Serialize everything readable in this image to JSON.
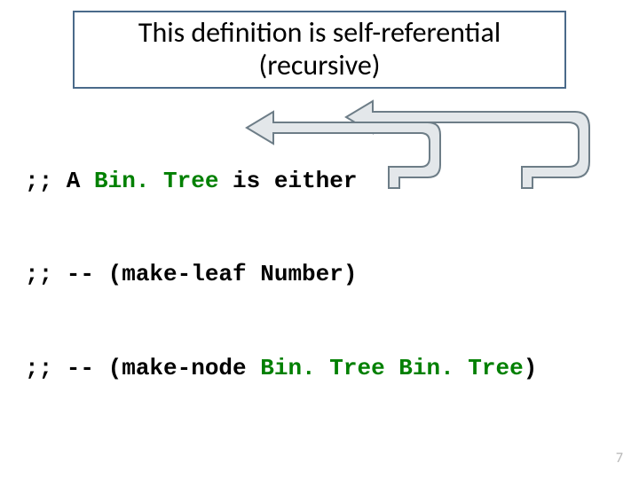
{
  "title": "This definition is self-referential (recursive)",
  "code": {
    "l1_prefix": ";; A ",
    "l1_type": "Bin. Tree",
    "l1_suffix": " is either",
    "l2": ";; -- (make-leaf Number)",
    "l3_prefix": ";; -- (make-node ",
    "l3_t1": "Bin. Tree",
    "l3_sep": " ",
    "l3_t2": "Bin. Tree",
    "l3_suffix": ")"
  },
  "page_number": "7",
  "arrows": {
    "stroke": "#6d7d87",
    "fill": "#e3e7ea"
  }
}
